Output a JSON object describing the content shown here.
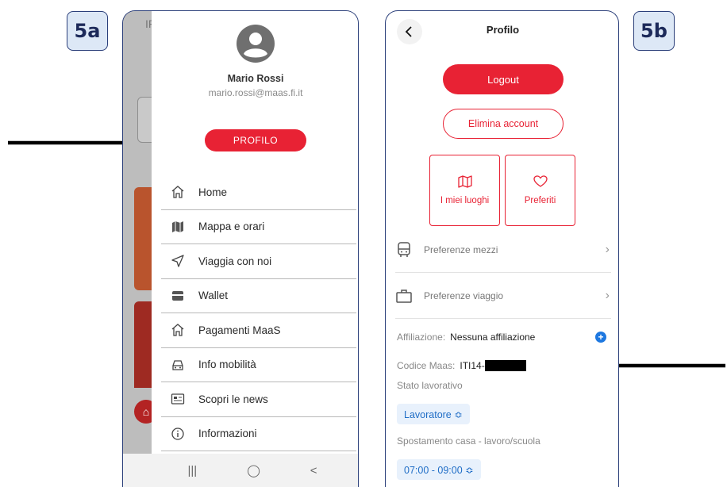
{
  "labels": {
    "left": "5a",
    "right": "5b"
  },
  "screen_a": {
    "bg_title_fragment": "IF",
    "user": {
      "name": "Mario Rossi",
      "email": "mario.rossi@maas.fi.it"
    },
    "profile_button": "PROFILO",
    "menu": [
      {
        "label": "Home",
        "icon": "home-icon"
      },
      {
        "label": "Mappa e orari",
        "icon": "map-icon"
      },
      {
        "label": "Viaggia con noi",
        "icon": "navigation-icon"
      },
      {
        "label": "Wallet",
        "icon": "wallet-icon"
      },
      {
        "label": "Pagamenti MaaS",
        "icon": "home-outline-icon"
      },
      {
        "label": "Info mobilità",
        "icon": "car-icon"
      },
      {
        "label": "Scopri le news",
        "icon": "news-icon"
      },
      {
        "label": "Informazioni",
        "icon": "info-icon"
      }
    ],
    "nav": {
      "recents": "|||",
      "home": "◯",
      "back": "<"
    }
  },
  "screen_b": {
    "title": "Profilo",
    "logout": "Logout",
    "delete_account": "Elimina account",
    "tiles": {
      "places": "I miei luoghi",
      "favorites": "Preferiti"
    },
    "pref_mezzi": "Preferenze mezzi",
    "pref_viaggio": "Preferenze viaggio",
    "affiliation_label": "Affiliazione:",
    "affiliation_value": "Nessuna affiliazione",
    "code_label": "Codice Maas:",
    "code_value": "ITI14-",
    "status_label": "Stato lavorativo",
    "status_value": "Lavoratore ≎",
    "commute_label": "Spostamento casa - lavoro/scuola",
    "commute_value": "07:00 - 09:00 ≎"
  },
  "colors": {
    "accent": "#e82234",
    "label_bg": "#dde8f6",
    "frame": "#2b3f7a",
    "link": "#1e78e0"
  }
}
